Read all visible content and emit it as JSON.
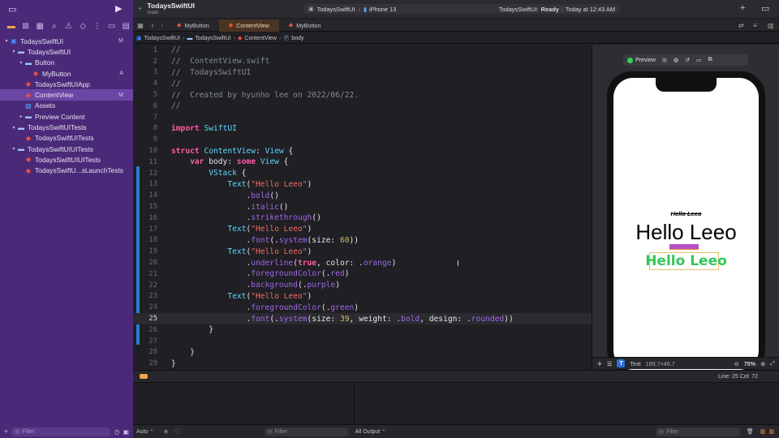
{
  "window": {
    "project_title": "TodaysSwiftUI",
    "branch": "main",
    "scheme_target": "TodaysSwiftUI",
    "device": "iPhone 13",
    "status_project": "TodaysSwiftUI:",
    "status_state": "Ready",
    "status_time": "Today at 12:43 AM"
  },
  "navigator": {
    "items": [
      {
        "label": "TodaysSwiftUI",
        "depth": 0,
        "icon": "project-icon",
        "badge": "M",
        "open": true
      },
      {
        "label": "TodaysSwiftUI",
        "depth": 1,
        "icon": "folder-icon",
        "badge": "",
        "open": true
      },
      {
        "label": "Button",
        "depth": 2,
        "icon": "folder-icon",
        "badge": "",
        "open": true
      },
      {
        "label": "MyButton",
        "depth": 3,
        "icon": "swift-file-icon",
        "badge": "A"
      },
      {
        "label": "TodaysSwiftUIApp",
        "depth": 2,
        "icon": "swift-file-icon",
        "badge": ""
      },
      {
        "label": "ContentView",
        "depth": 2,
        "icon": "swift-file-icon",
        "badge": "M",
        "selected": true
      },
      {
        "label": "Assets",
        "depth": 2,
        "icon": "assets-icon",
        "badge": ""
      },
      {
        "label": "Preview Content",
        "depth": 2,
        "icon": "folder-icon",
        "badge": "",
        "open": false
      },
      {
        "label": "TodaysSwiftUITests",
        "depth": 1,
        "icon": "folder-icon",
        "badge": "",
        "open": true
      },
      {
        "label": "TodaysSwiftUITests",
        "depth": 2,
        "icon": "swift-file-icon",
        "badge": ""
      },
      {
        "label": "TodaysSwiftUIUITests",
        "depth": 1,
        "icon": "folder-icon",
        "badge": "",
        "open": true
      },
      {
        "label": "TodaysSwiftUIUITests",
        "depth": 2,
        "icon": "swift-file-icon",
        "badge": ""
      },
      {
        "label": "TodaysSwiftU...sLaunchTests",
        "depth": 2,
        "icon": "swift-file-icon",
        "badge": ""
      }
    ],
    "filter_placeholder": "Filter"
  },
  "tabs": [
    {
      "label": "MyButton",
      "active": false
    },
    {
      "label": "ContentView",
      "active": true
    },
    {
      "label": "MyButton",
      "active": false
    }
  ],
  "jumpbar": [
    "TodaysSwiftUI",
    "TodaysSwiftUI",
    "ContentView",
    "body"
  ],
  "editor": {
    "current_line": 25,
    "lines": [
      {
        "n": "1",
        "t": "//"
      },
      {
        "n": "2",
        "t": "//  ContentView.swift"
      },
      {
        "n": "3",
        "t": "//  TodaysSwiftUI"
      },
      {
        "n": "4",
        "t": "//"
      },
      {
        "n": "5",
        "t": "//  Created by hyunho lee on 2022/06/22."
      },
      {
        "n": "6",
        "t": "//"
      },
      {
        "n": "7",
        "t": ""
      },
      {
        "n": "8",
        "t": "import SwiftUI"
      },
      {
        "n": "9",
        "t": ""
      },
      {
        "n": "10",
        "t": "struct ContentView: View {"
      },
      {
        "n": "11",
        "t": "    var body: some View {"
      },
      {
        "n": "12",
        "t": "        VStack {"
      },
      {
        "n": "13",
        "t": "            Text(\"Hello Leeo\")"
      },
      {
        "n": "14",
        "t": "                .bold()"
      },
      {
        "n": "15",
        "t": "                .italic()"
      },
      {
        "n": "16",
        "t": "                .strikethrough()"
      },
      {
        "n": "17",
        "t": "            Text(\"Hello Leeo\")"
      },
      {
        "n": "18",
        "t": "                .font(.system(size: 60))"
      },
      {
        "n": "19",
        "t": "            Text(\"Hello Leeo\")"
      },
      {
        "n": "20",
        "t": "                .underline(true, color: .orange)"
      },
      {
        "n": "21",
        "t": "                .foregroundColor(.red)"
      },
      {
        "n": "22",
        "t": "                .background(.purple)"
      },
      {
        "n": "23",
        "t": "            Text(\"Hello Leeo\")"
      },
      {
        "n": "24",
        "t": "                .foregroundColor(.green)"
      },
      {
        "n": "25",
        "t": "                .font(.system(size: 39, weight: .bold, design: .rounded))"
      },
      {
        "n": "26",
        "t": "        }"
      },
      {
        "n": "27",
        "t": ""
      },
      {
        "n": "28",
        "t": "    }"
      },
      {
        "n": "29",
        "t": "}"
      }
    ]
  },
  "preview": {
    "button_label": "Preview",
    "texts": [
      "Hello Leeo",
      "Hello Leeo",
      "Hello Leeo"
    ],
    "selected_kind": "Text",
    "selected_size": "189.7×46.7",
    "zoom": "75%"
  },
  "status": {
    "position": "Line: 25  Col: 72",
    "auto_label": "Auto",
    "filter_placeholder": "Filter",
    "output_label": "All Output"
  },
  "colors": {
    "navigator_bg": "#4a2a78",
    "active_tab": "#4a3522",
    "keyword": "#fc5fa3",
    "string": "#fc6a5d",
    "type": "#5dd8ff",
    "preview_green": "#34c759"
  }
}
